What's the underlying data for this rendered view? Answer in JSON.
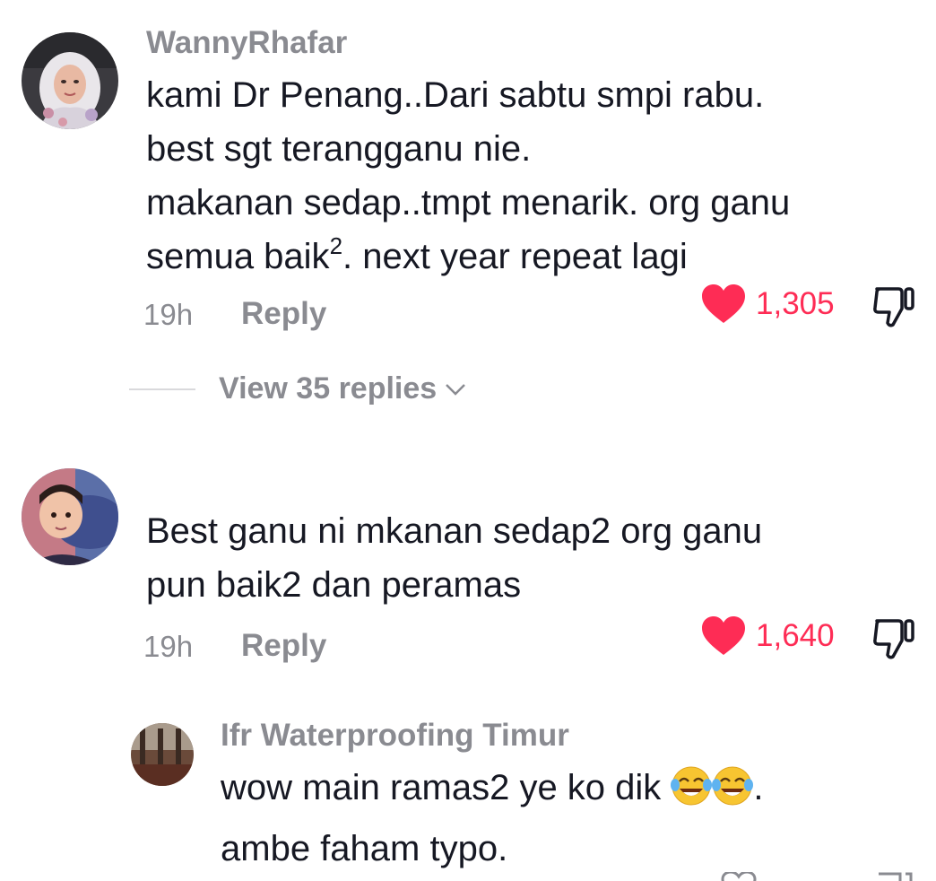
{
  "comments": [
    {
      "username": "WannyRhafar",
      "lines": [
        "kami Dr Penang..Dari sabtu smpi rabu.",
        "best sgt terangganu nie.",
        "makanan sedap..tmpt menarik. org ganu"
      ],
      "last_line_pre": "semua baik",
      "last_line_sup": "2",
      "last_line_post": ". next year repeat lagi",
      "time": "19h",
      "reply_label": "Reply",
      "likes": "1,305",
      "view_replies": "View 35 replies",
      "avatar_icon": "user-avatar-hijab-photo"
    },
    {
      "username": "",
      "lines": [
        "Best ganu ni mkanan sedap2 org ganu",
        "pun baik2 dan peramas"
      ],
      "time": "19h",
      "reply_label": "Reply",
      "likes": "1,640",
      "avatar_icon": "user-avatar-child-photo"
    }
  ],
  "reply": {
    "username": "Ifr Waterproofing Timur",
    "line1_pre": "wow main ramas2 ye ko dik ",
    "line1_emojis": [
      "face-with-tears-of-joy",
      "face-with-tears-of-joy"
    ],
    "line1_post": ".",
    "line2": "ambe faham typo.",
    "avatar_icon": "user-avatar-room-photo"
  },
  "colors": {
    "like_red": "#fe2c55",
    "muted_gray": "#8a8b91",
    "text_dark": "#161823"
  }
}
